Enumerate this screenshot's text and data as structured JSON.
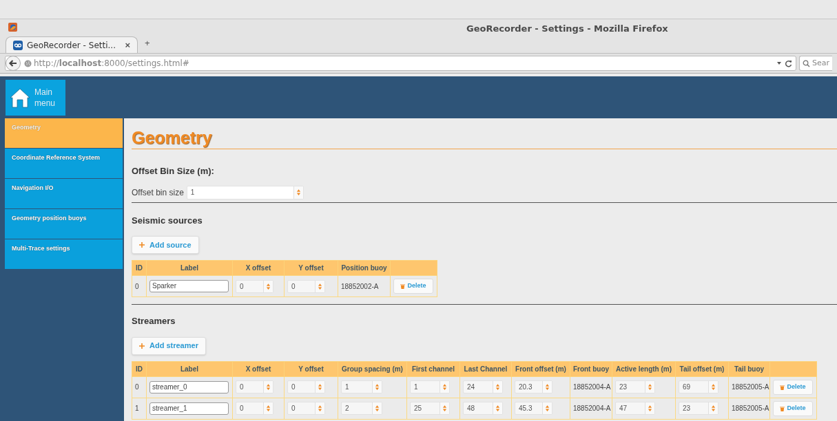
{
  "browser": {
    "window_title": "GeoRecorder - Settings - Mozilla Firefox",
    "tab_title": "GeoRecorder - Setti...",
    "tab_close": "×",
    "new_tab": "+",
    "url": "http://**localhost**:8000/settings.html#",
    "search_placeholder": "Sear"
  },
  "header": {
    "main_menu": "Main menu"
  },
  "sidebar": [
    {
      "label": "Geometry",
      "selected": true
    },
    {
      "label": "Coordinate Reference System",
      "selected": false
    },
    {
      "label": "Navigation I/O",
      "selected": false
    },
    {
      "label": "Geometry position buoys",
      "selected": false
    },
    {
      "label": "Multi-Trace settings",
      "selected": false
    }
  ],
  "page": {
    "title": "Geometry",
    "offset_bin": {
      "heading": "Offset Bin Size (m):",
      "label": "Offset bin size",
      "value": "1"
    },
    "tables": [
      {
        "heading": "Seismic sources",
        "add_button": "Add source",
        "columns": [
          "ID",
          "Label",
          "X offset",
          "Y offset",
          "Position buoy",
          ""
        ],
        "rows": [
          {
            "cells": [
              {
                "kind": "text",
                "value": "0"
              },
              {
                "kind": "input",
                "value": "Sparker"
              },
              {
                "kind": "number",
                "value": "0"
              },
              {
                "kind": "number",
                "value": "0"
              },
              {
                "kind": "text",
                "value": "18852002-A"
              },
              {
                "kind": "button",
                "value": "Delete"
              }
            ]
          }
        ]
      },
      {
        "heading": "Streamers",
        "add_button": "Add streamer",
        "columns": [
          "ID",
          "Label",
          "X offset",
          "Y offset",
          "Group spacing (m)",
          "First channel",
          "Last Channel",
          "Front offset (m)",
          "Front buoy",
          "Active length (m)",
          "Tail offset (m)",
          "Tail buoy",
          ""
        ],
        "rows": [
          {
            "cells": [
              {
                "kind": "text",
                "value": "0"
              },
              {
                "kind": "input",
                "value": "streamer_0"
              },
              {
                "kind": "number",
                "value": "0"
              },
              {
                "kind": "number",
                "value": "0"
              },
              {
                "kind": "number",
                "value": "1"
              },
              {
                "kind": "number",
                "value": "1"
              },
              {
                "kind": "number",
                "value": "24"
              },
              {
                "kind": "number",
                "value": "20.3"
              },
              {
                "kind": "text",
                "value": "18852004-A"
              },
              {
                "kind": "number",
                "value": "23"
              },
              {
                "kind": "number",
                "value": "69"
              },
              {
                "kind": "text",
                "value": "18852005-A"
              },
              {
                "kind": "button",
                "value": "Delete"
              }
            ]
          },
          {
            "cells": [
              {
                "kind": "text",
                "value": "1"
              },
              {
                "kind": "input",
                "value": "streamer_1"
              },
              {
                "kind": "number",
                "value": "0"
              },
              {
                "kind": "number",
                "value": "0"
              },
              {
                "kind": "number",
                "value": "2"
              },
              {
                "kind": "number",
                "value": "25"
              },
              {
                "kind": "number",
                "value": "48"
              },
              {
                "kind": "number",
                "value": "45.3"
              },
              {
                "kind": "text",
                "value": "18852004-A"
              },
              {
                "kind": "number",
                "value": "47"
              },
              {
                "kind": "number",
                "value": "23"
              },
              {
                "kind": "text",
                "value": "18852005-A"
              },
              {
                "kind": "button",
                "value": "Delete"
              }
            ]
          }
        ]
      }
    ]
  }
}
